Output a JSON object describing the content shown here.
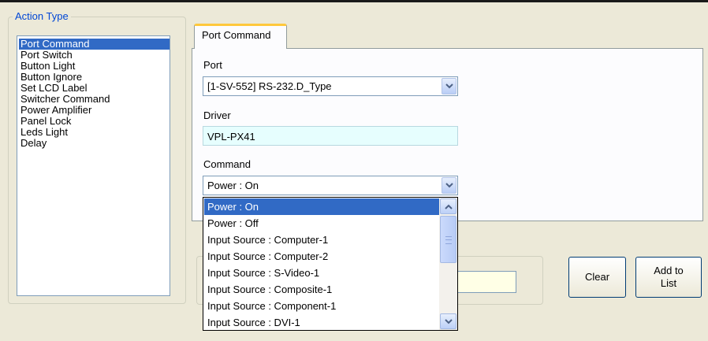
{
  "action_type": {
    "legend": "Action Type",
    "items": [
      "Port Command",
      "Port Switch",
      "Button Light",
      "Button Ignore",
      "Set LCD Label",
      "Switcher Command",
      "Power Amplifier",
      "Panel Lock",
      "Leds Light",
      "Delay"
    ],
    "selected": "Port Command"
  },
  "tabs": [
    {
      "label": "Port Command",
      "active": true
    }
  ],
  "port": {
    "label": "Port",
    "value": "[1-SV-552] RS-232.D_Type"
  },
  "driver": {
    "label": "Driver",
    "value": "VPL-PX41"
  },
  "command": {
    "label": "Command",
    "value": "Power : On",
    "options": [
      "Power : On",
      "Power : Off",
      "Input Source : Computer-1",
      "Input Source : Computer-2",
      "Input Source : S-Video-1",
      "Input Source : Composite-1",
      "Input Source : Component-1",
      "Input Source : DVI-1"
    ],
    "highlighted": "Power : On"
  },
  "buttons": {
    "clear": "Clear",
    "add_line1": "Add to",
    "add_line2": "List"
  },
  "colors": {
    "selection": "#316ac5",
    "legend": "#0046d5",
    "tab_accent": "#ffc83c",
    "driver_bg": "#e6fefe"
  },
  "icons": [
    "chevron-down-icon",
    "scroll-up-icon",
    "scroll-down-icon",
    "scroll-thumb-grip-icon"
  ]
}
